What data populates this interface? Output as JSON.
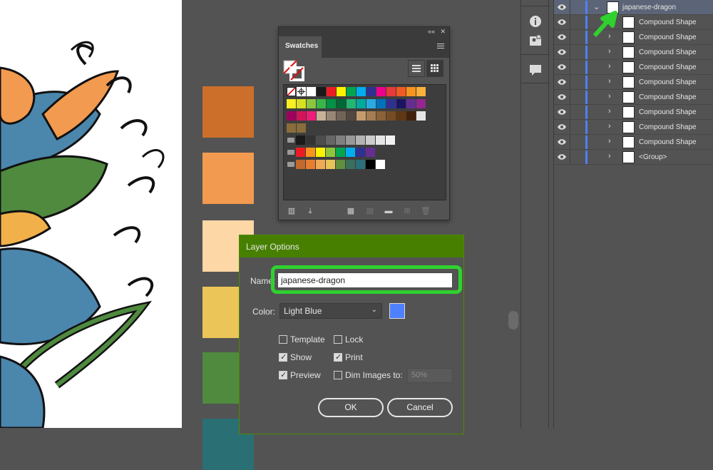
{
  "swatches_panel": {
    "tab_label": "Swatches",
    "collapse_icon": "double-chevron-icon",
    "close_icon": "close-icon",
    "rows": [
      [
        "#ffffff",
        "#ffffff",
        "#ffffff",
        "#1a1a1a",
        "#ed1c24",
        "#fff200",
        "#00a651",
        "#00aeef",
        "#2e3192",
        "#ec008c",
        "#e83a3a",
        "#f15a24",
        "#f7941d",
        "#fbb03b"
      ],
      [
        "#fcee21",
        "#d9e021",
        "#8cc63f",
        "#39b54a",
        "#009245",
        "#006837",
        "#22b573",
        "#00a99d",
        "#29abe2",
        "#0071bc",
        "#2e3192",
        "#1b1464",
        "#662d91",
        "#93278f"
      ],
      [
        "#9e005d",
        "#d4145a",
        "#ed1e79",
        "#c7b299",
        "#998675",
        "#736357",
        "#534741",
        "#c69c6d",
        "#a67c52",
        "#8c6239",
        "#754c24",
        "#603813",
        "#42210b",
        "#e6e6e6"
      ],
      [
        "#8a6d3b",
        "#8a6d3b"
      ],
      [
        "#1a1a1a",
        "#333333",
        "#4d4d4d",
        "#666666",
        "#808080",
        "#999999",
        "#b3b3b3",
        "#cccccc",
        "#e6e6e6",
        "#f2f2f2"
      ],
      [
        "#ed1c24",
        "#f7941d",
        "#fff200",
        "#8cc63f",
        "#00a651",
        "#00aeef",
        "#2e3192",
        "#662d91"
      ],
      [
        "#c1692e",
        "#e67e32",
        "#f1a957",
        "#e8c35a",
        "#5f8f3f",
        "#3a6f5c",
        "#2a6f7a",
        "#000000",
        "#ffffff"
      ]
    ]
  },
  "canvas_swatches": [
    "#cc6f2a",
    "#f29a4f",
    "#fdd7a6",
    "#ecc558",
    "#4f8a3f",
    "#2a6f74"
  ],
  "dialog": {
    "title": "Layer Options",
    "name_label": "Name:",
    "name_value": "japanese-dragon",
    "color_label": "Color:",
    "color_value": "Light Blue",
    "color_swatch": "#4f80ff",
    "template_label": "Template",
    "lock_label": "Lock",
    "show_label": "Show",
    "print_label": "Print",
    "preview_label": "Preview",
    "dim_label": "Dim Images to:",
    "dim_value": "50%",
    "ok_label": "OK",
    "cancel_label": "Cancel",
    "checks": {
      "template": false,
      "lock": false,
      "show": true,
      "print": true,
      "preview": true,
      "dim": false
    }
  },
  "toolstrip": {
    "tools": [
      "info-icon",
      "asset-export-icon",
      "comments-icon"
    ]
  },
  "layers": {
    "rows": [
      {
        "name": "japanese-dragon",
        "expanded": true,
        "selected": true
      },
      {
        "name": "Compound Shape"
      },
      {
        "name": "Compound Shape"
      },
      {
        "name": "Compound Shape"
      },
      {
        "name": "Compound Shape"
      },
      {
        "name": "Compound Shape"
      },
      {
        "name": "Compound Shape"
      },
      {
        "name": "Compound Shape"
      },
      {
        "name": "Compound Shape"
      },
      {
        "name": "Compound Shape"
      },
      {
        "name": "<Group>"
      }
    ],
    "layer_color": "#4f80ff",
    "annotation_arrow_color": "#2fd12f"
  }
}
